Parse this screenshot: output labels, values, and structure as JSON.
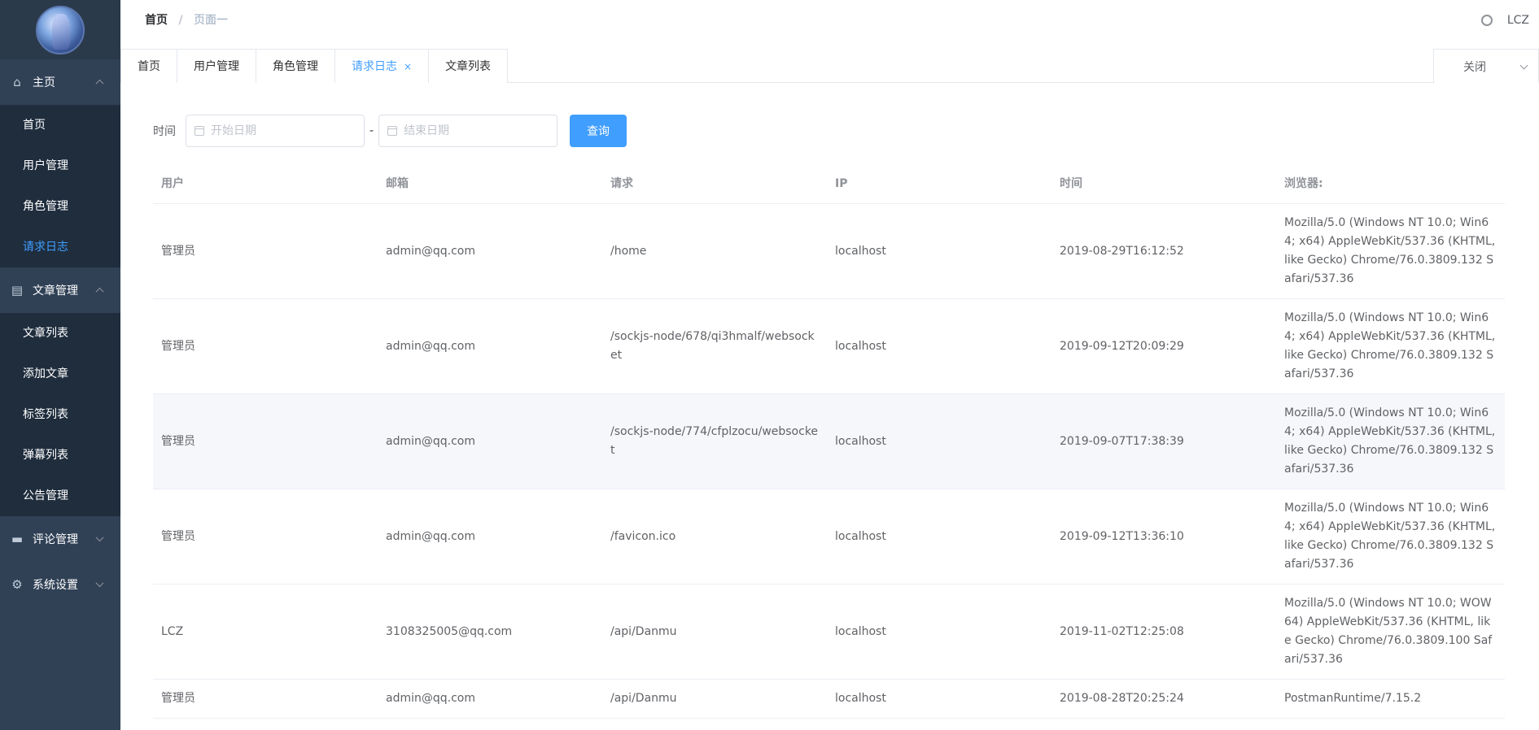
{
  "sidebar": {
    "groups": [
      {
        "title": "主页",
        "icon": "home-icon",
        "expanded": true,
        "items": [
          {
            "label": "首页",
            "active": false
          },
          {
            "label": "用户管理",
            "active": false
          },
          {
            "label": "角色管理",
            "active": false
          },
          {
            "label": "请求日志",
            "active": true
          }
        ]
      },
      {
        "title": "文章管理",
        "icon": "document-icon",
        "expanded": true,
        "items": [
          {
            "label": "文章列表",
            "active": false
          },
          {
            "label": "添加文章",
            "active": false
          },
          {
            "label": "标签列表",
            "active": false
          },
          {
            "label": "弹幕列表",
            "active": false
          },
          {
            "label": "公告管理",
            "active": false
          }
        ]
      },
      {
        "title": "评论管理",
        "icon": "chat-icon",
        "expanded": false,
        "items": []
      },
      {
        "title": "系统设置",
        "icon": "gear-icon",
        "expanded": false,
        "items": []
      }
    ]
  },
  "header": {
    "breadcrumb_home": "首页",
    "breadcrumb_current": "页面一",
    "username": "LCZ"
  },
  "tags": {
    "items": [
      {
        "label": "首页",
        "active": false
      },
      {
        "label": "用户管理",
        "active": false
      },
      {
        "label": "角色管理",
        "active": false
      },
      {
        "label": "请求日志",
        "active": true
      },
      {
        "label": "文章列表",
        "active": false
      }
    ],
    "close_label": "关闭"
  },
  "filters": {
    "label": "时间",
    "start_placeholder": "开始日期",
    "end_placeholder": "结束日期",
    "separator": "-",
    "query_label": "查询"
  },
  "table": {
    "columns": [
      "用户",
      "邮箱",
      "请求",
      "IP",
      "时间",
      "浏览器:"
    ],
    "rows": [
      [
        "管理员",
        "admin@qq.com",
        "/home",
        "localhost",
        "2019-08-29T16:12:52",
        "Mozilla/5.0 (Windows NT 10.0; Win64; x64) AppleWebKit/537.36 (KHTML, like Gecko) Chrome/76.0.3809.132 Safari/537.36"
      ],
      [
        "管理员",
        "admin@qq.com",
        "/sockjs-node/678/qi3hmalf/websocket",
        "localhost",
        "2019-09-12T20:09:29",
        "Mozilla/5.0 (Windows NT 10.0; Win64; x64) AppleWebKit/537.36 (KHTML, like Gecko) Chrome/76.0.3809.132 Safari/537.36"
      ],
      [
        "管理员",
        "admin@qq.com",
        "/sockjs-node/774/cfplzocu/websocket",
        "localhost",
        "2019-09-07T17:38:39",
        "Mozilla/5.0 (Windows NT 10.0; Win64; x64) AppleWebKit/537.36 (KHTML, like Gecko) Chrome/76.0.3809.132 Safari/537.36"
      ],
      [
        "管理员",
        "admin@qq.com",
        "/favicon.ico",
        "localhost",
        "2019-09-12T13:36:10",
        "Mozilla/5.0 (Windows NT 10.0; Win64; x64) AppleWebKit/537.36 (KHTML, like Gecko) Chrome/76.0.3809.132 Safari/537.36"
      ],
      [
        "LCZ",
        "3108325005@qq.com",
        "/api/Danmu",
        "localhost",
        "2019-11-02T12:25:08",
        "Mozilla/5.0 (Windows NT 10.0; WOW64) AppleWebKit/537.36 (KHTML, like Gecko) Chrome/76.0.3809.100 Safari/537.36"
      ],
      [
        "管理员",
        "admin@qq.com",
        "/api/Danmu",
        "localhost",
        "2019-08-28T20:25:24",
        "PostmanRuntime/7.15.2"
      ]
    ],
    "striped_row_index": 2
  },
  "colors": {
    "sidebar_bg": "#304156",
    "submenu_bg": "#1f2d3d",
    "accent": "#409eff"
  }
}
